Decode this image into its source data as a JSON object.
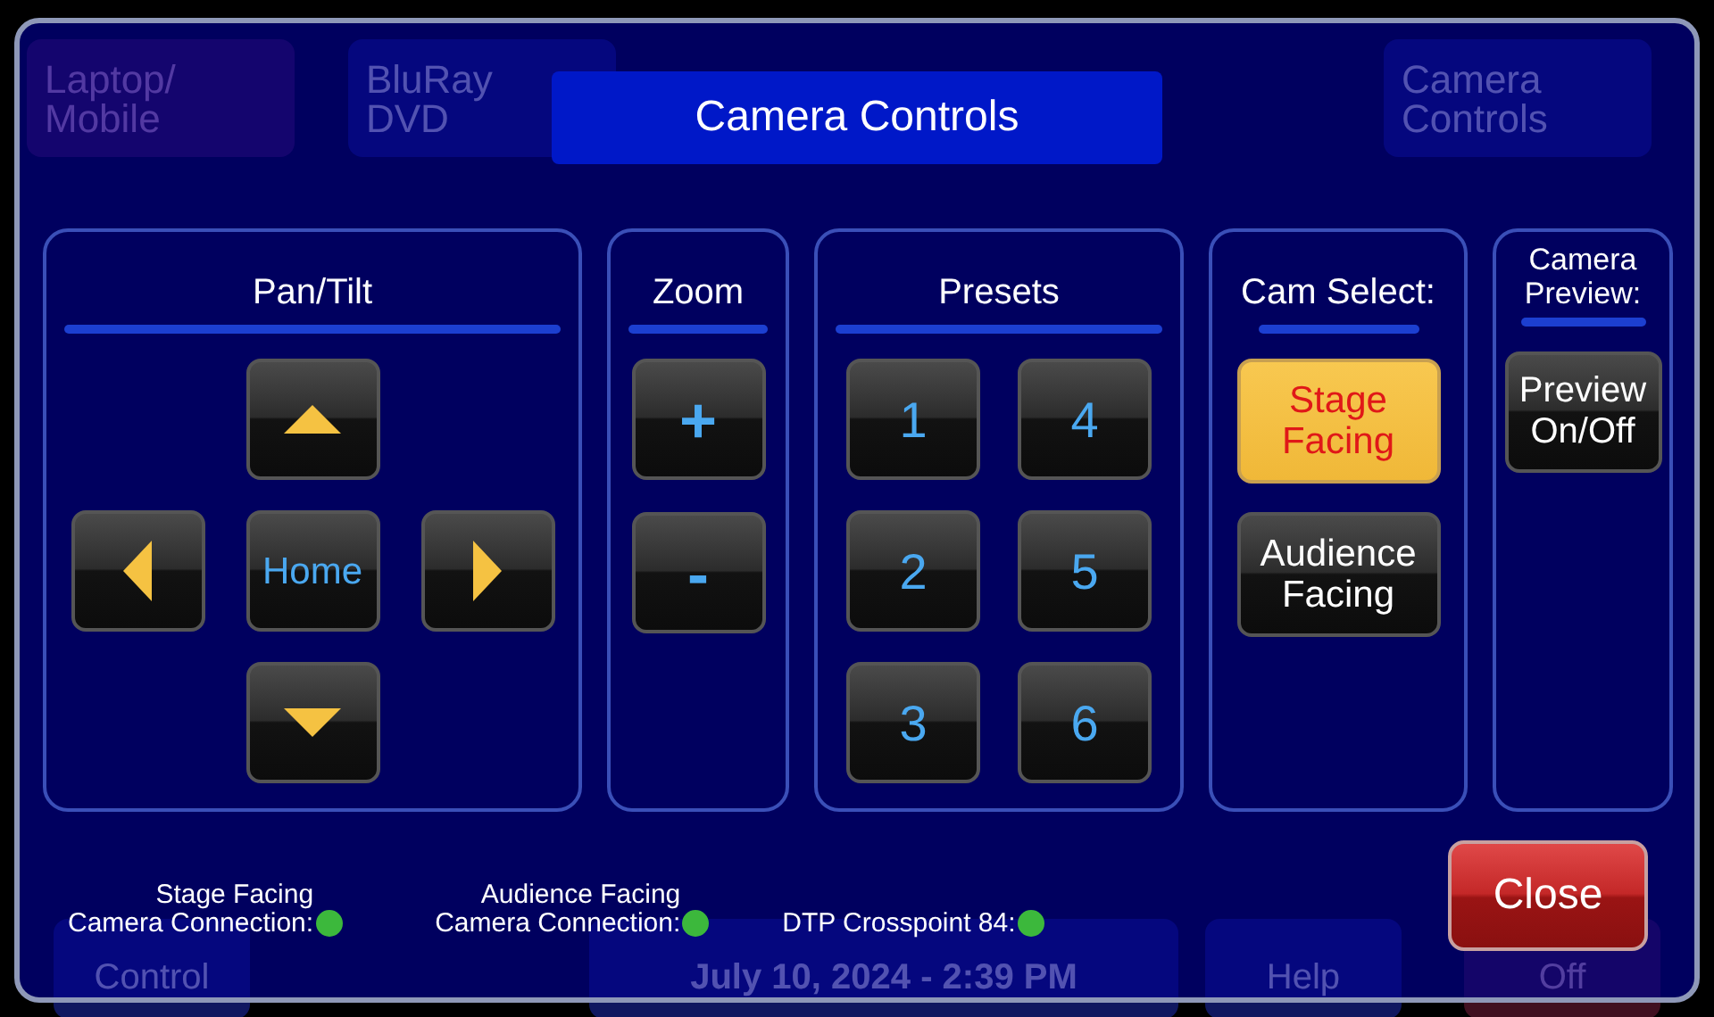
{
  "background": {
    "source_tabs": [
      {
        "label": "Laptop/\nMobile",
        "selected": true
      },
      {
        "label": "BluRay\nDVD",
        "selected": false
      },
      {
        "label": "Camera\nControls",
        "selected": false
      }
    ],
    "bottom_bar": [
      {
        "kind": "button",
        "label": "Control"
      },
      {
        "kind": "clock",
        "label": "July 10, 2024  -  2:39 PM"
      },
      {
        "kind": "button",
        "label": "Help"
      },
      {
        "kind": "power",
        "label": "Off"
      }
    ]
  },
  "dialog": {
    "title": "Camera Controls",
    "pan_tilt": {
      "title": "Pan/Tilt",
      "home": "Home"
    },
    "zoom": {
      "title": "Zoom",
      "zoom_in": "+",
      "zoom_out": "-"
    },
    "presets": {
      "title": "Presets",
      "buttons": [
        "1",
        "4",
        "2",
        "5",
        "3",
        "6"
      ]
    },
    "cam_select": {
      "title": "Cam Select:",
      "options": [
        {
          "label": "Stage\nFacing",
          "selected": true
        },
        {
          "label": "Audience\nFacing",
          "selected": false
        }
      ]
    },
    "preview": {
      "title": "Camera\nPreview:",
      "button": "Preview\nOn/Off"
    },
    "status": [
      {
        "label": "Stage Facing\nCamera Connection:",
        "connected": true
      },
      {
        "label": "Audience Facing\nCamera Connection:",
        "connected": true
      },
      {
        "label": "DTP Crosspoint 84:",
        "connected": true
      }
    ],
    "close": "Close"
  }
}
